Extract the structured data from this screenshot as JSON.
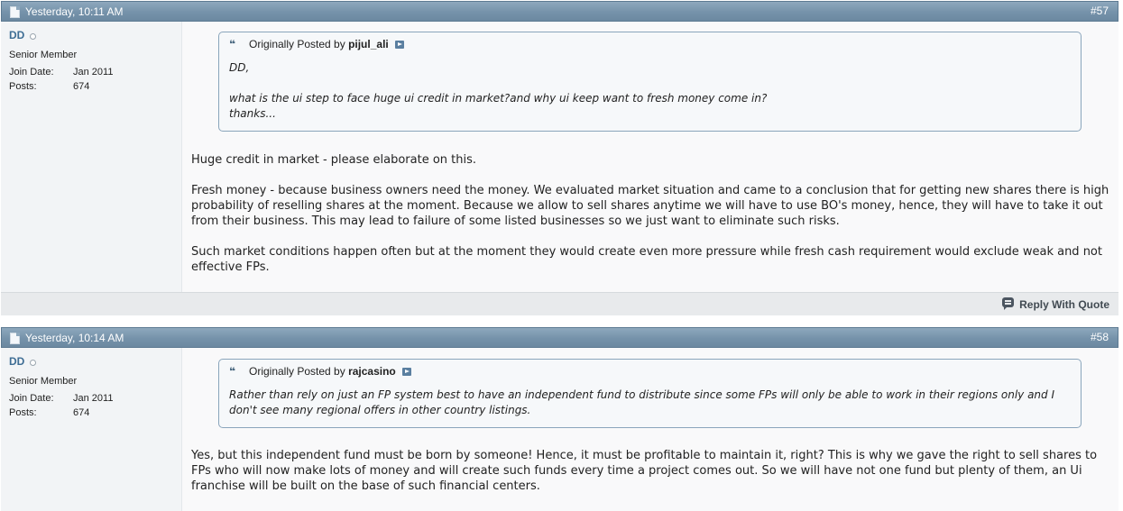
{
  "posts": [
    {
      "date": "Yesterday, 10:11 AM",
      "number": "#57",
      "user": {
        "name": "DD",
        "title": "Senior Member",
        "join_label": "Join Date:",
        "join_value": "Jan 2011",
        "posts_label": "Posts:",
        "posts_value": "674"
      },
      "quote": {
        "prefix": "Originally Posted by",
        "author": "pijul_ali",
        "lines": [
          "DD,",
          "",
          "what is the ui step to face huge ui credit in market?and why ui keep want to fresh money come in?",
          "thanks..."
        ]
      },
      "paragraphs": [
        "Huge credit in market - please elaborate on this.",
        "Fresh money - because business owners need the money. We evaluated market situation and came to a conclusion that for getting new shares there is high probability of reselling shares at the moment. Because we allow to sell shares anytime we will have to use BO's money, hence, they will have to take it out from their business. This may lead to failure of some listed businesses so we just want to eliminate such risks.",
        "Such market conditions happen often but at the moment they would create even more pressure while fresh cash requirement would exclude weak and not effective FPs."
      ],
      "reply_label": "Reply With Quote"
    },
    {
      "date": "Yesterday, 10:14 AM",
      "number": "#58",
      "user": {
        "name": "DD",
        "title": "Senior Member",
        "join_label": "Join Date:",
        "join_value": "Jan 2011",
        "posts_label": "Posts:",
        "posts_value": "674"
      },
      "quote": {
        "prefix": "Originally Posted by",
        "author": "rajcasino",
        "lines": [
          "Rather than rely on just an FP system best to have an independent fund to distribute since some FPs will only be able to work in their regions only and I don't see many regional offers in other country listings."
        ]
      },
      "paragraphs": [
        "Yes, but this independent fund must be born by someone! Hence, it must be profitable to maintain it, right? This is why we gave the right to sell shares to FPs who will now make lots of money and will create such funds every time a project comes out. So we will have not one fund but plenty of them, an Ui franchise will be built on the base of such financial centers."
      ]
    }
  ],
  "icons": {
    "post_icon": "document-icon",
    "online_status": "offline-status-icon",
    "quote_icon": "quote-icon",
    "view_post": "view-post-icon",
    "reply_icon": "reply-quote-icon"
  },
  "colors": {
    "header_bar": "#7592aa",
    "username": "#3e6d94",
    "quote_border": "#8aa5bb"
  }
}
